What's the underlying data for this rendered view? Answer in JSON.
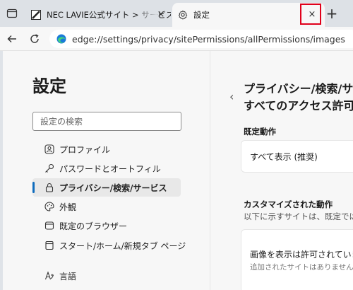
{
  "browser": {
    "tabs": [
      {
        "title": "NEC LAVIE公式サイト > サービス&サポート",
        "close": "×"
      },
      {
        "title": "設定",
        "close": "×"
      }
    ],
    "new_tab": "+",
    "address": "edge://settings/privacy/sitePermissions/allPermissions/images"
  },
  "sidebar": {
    "title": "設定",
    "search_placeholder": "設定の検索",
    "items": [
      {
        "label": "プロファイル",
        "icon": "profile-icon"
      },
      {
        "label": "パスワードとオートフィル",
        "icon": "key-icon"
      },
      {
        "label": "プライバシー/検索/サービス",
        "icon": "lock-icon",
        "active": true
      },
      {
        "label": "外観",
        "icon": "palette-icon"
      },
      {
        "label": "既定のブラウザー",
        "icon": "browser-icon"
      },
      {
        "label": "スタート/ホーム/新規タブ ページ",
        "icon": "home-tab-icon"
      },
      {
        "label": "言語",
        "icon": "language-icon"
      }
    ]
  },
  "main": {
    "title_line1": "プライバシー/検索/サービス",
    "title_line2": "すべてのアクセス許可",
    "default_label": "既定動作",
    "default_value": "すべて表示 (推奨)",
    "custom_label": "カスタマイズされた動作",
    "custom_desc": "以下に示すサイトは、既定ではなくカスタム設定に従います",
    "allowed_title": "画像を表示は許可されています",
    "allowed_sub": "追加されたサイトはありません"
  }
}
